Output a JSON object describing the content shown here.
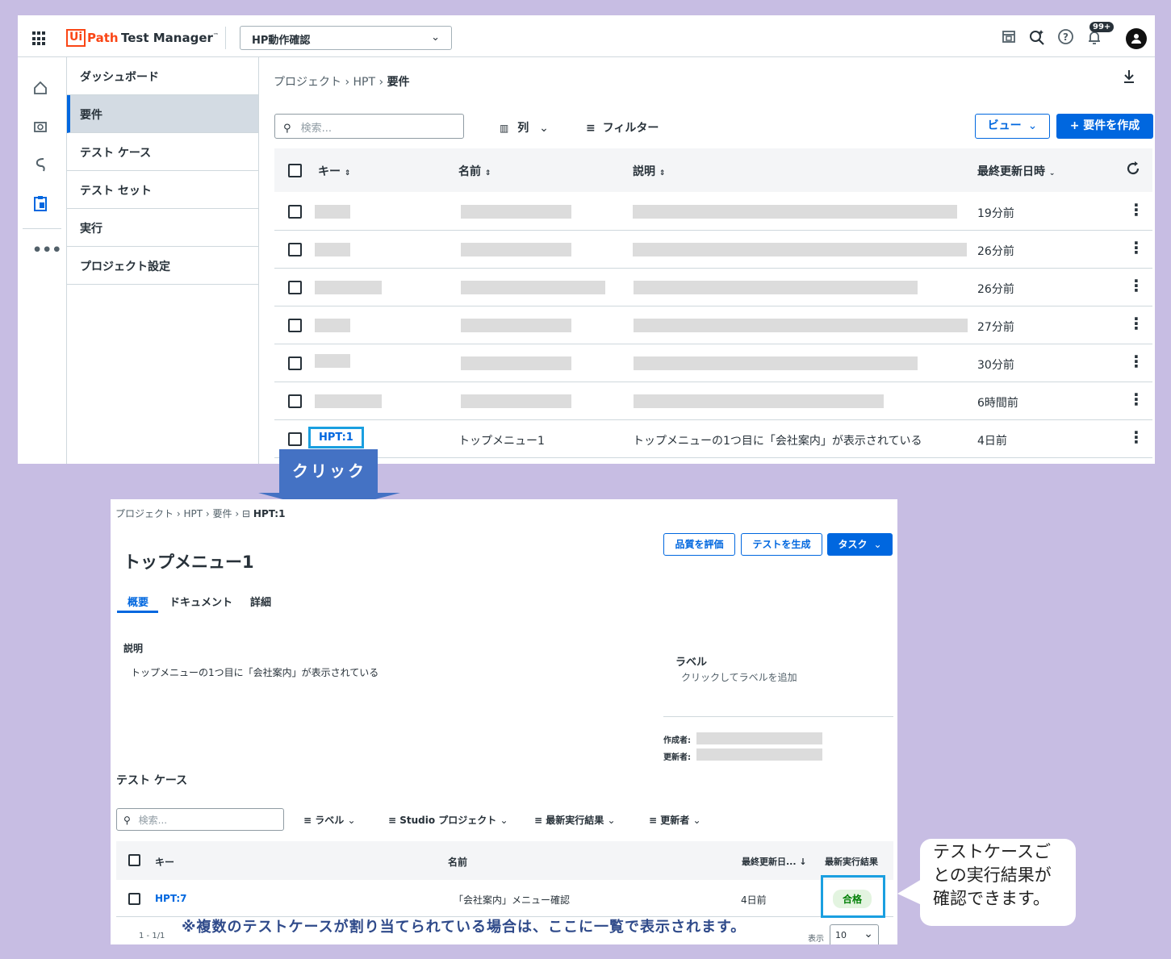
{
  "top": {
    "brand": {
      "ui": "Ui",
      "path": "Path",
      "product": "Test Manager",
      "tm_mark": "™"
    },
    "project_select": {
      "value": "HP動作確認",
      "chevron": "⌄"
    },
    "notification_badge": "99+",
    "nav": {
      "items": [
        "ダッシュボード",
        "要件",
        "テスト ケース",
        "テスト セット",
        "実行",
        "プロジェクト設定"
      ],
      "selected": "要件"
    },
    "breadcrumb": {
      "p1": "プロジェクト",
      "p2": "HPT",
      "p3": "要件",
      "sep": "›"
    },
    "search_placeholder": "検索...",
    "columns_label": "列",
    "filter_label": "フィルター",
    "view_label": "ビュー",
    "create_label": "+ 要件を作成",
    "table": {
      "headers": {
        "key": "キー",
        "name": "名前",
        "desc": "説明",
        "updated": "最終更新日時"
      },
      "rows": [
        {
          "time": "19分前"
        },
        {
          "time": "26分前"
        },
        {
          "time": "26分前"
        },
        {
          "time": "27分前"
        },
        {
          "time": "30分前"
        },
        {
          "time": "6時間前"
        },
        {
          "key": "HPT:1",
          "name": "トップメニュー1",
          "desc": "トップメニューの1つ目に「会社案内」が表示されている",
          "time": "4日前"
        }
      ]
    }
  },
  "callout_click": "クリック",
  "detail": {
    "breadcrumb": {
      "p1": "プロジェクト",
      "p2": "HPT",
      "p3": "要件",
      "p4": "HPT:1",
      "sep": "›"
    },
    "buttons": {
      "evaluate": "品質を評価",
      "generate": "テストを生成",
      "task": "タスク"
    },
    "title": "トップメニュー1",
    "tabs": [
      "概要",
      "ドキュメント",
      "詳細"
    ],
    "description_label": "説明",
    "description": "トップメニューの1つ目に「会社案内」が表示されている",
    "label_heading": "ラベル",
    "label_add": "クリックしてラベルを追加",
    "created_by": "作成者:",
    "updated_by": "更新者:",
    "test_cases_heading": "テスト ケース",
    "search_placeholder": "検索...",
    "filters": [
      "ラベル",
      "Studio プロジェクト",
      "最新実行結果",
      "更新者"
    ],
    "table": {
      "headers": {
        "key": "キー",
        "name": "名前",
        "updated": "最終更新日...",
        "result": "最新実行結果"
      },
      "rows": [
        {
          "key": "HPT:7",
          "name": "「会社案内」メニュー確認",
          "updated": "4日前",
          "result": "合格"
        }
      ]
    },
    "pagination": {
      "range": "1 - 1/1",
      "show": "表示",
      "page_size": "10"
    },
    "note": "※複数のテストケースが割り当てられている場合は、ここに一覧で表示されます。"
  },
  "bubble": "テストケースごとの実行結果が確認できます。",
  "colors": {
    "accent": "#0067df",
    "highlight": "#1a9fe0",
    "brand": "#fa4616",
    "background": "#c7bde3",
    "arrow": "#4472c4"
  }
}
